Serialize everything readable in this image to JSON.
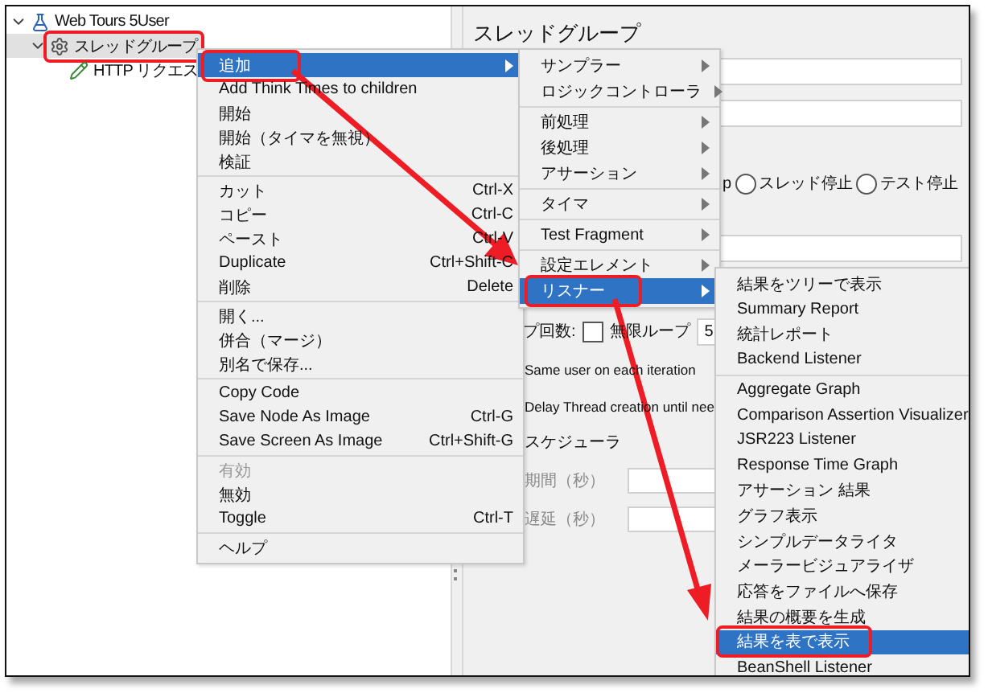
{
  "tree": [
    {
      "kind": "test_plan",
      "label": "Web Tours 5User",
      "expanded": true,
      "selected": false,
      "annotated": false,
      "children": [
        {
          "kind": "thread_group",
          "label": "スレッドグループ",
          "expanded": true,
          "selected": true,
          "annotated": true,
          "children": [
            {
              "kind": "sampler",
              "label": "HTTP リクエス",
              "selected": false,
              "annotated": false
            }
          ]
        }
      ]
    }
  ],
  "editor": {
    "title": "スレッドグループ",
    "error_action": {
      "partial_label": "p",
      "options": [
        {
          "label": "スレッド停止",
          "selected": false
        },
        {
          "label": "テスト停止",
          "selected": false
        }
      ]
    },
    "loop_count": {
      "label": "プ回数:",
      "infinite": {
        "label": "無限ループ",
        "checked": false
      },
      "value": "5"
    },
    "options": [
      {
        "label": "Same user on each iteration"
      },
      {
        "label": "Delay Thread creation until nee"
      }
    ],
    "scheduler_label": "スケジューラ",
    "timing_fields": [
      {
        "label": "期間（秒）",
        "disabled": true
      },
      {
        "label": "遅延（秒）",
        "disabled": true
      }
    ]
  },
  "context_menu": {
    "groups": [
      [
        {
          "label": "追加",
          "has_submenu": true,
          "selected": true,
          "disabled": false,
          "annotated": true
        },
        {
          "label": "Add Think Times to children",
          "has_submenu": false,
          "selected": false,
          "disabled": false,
          "annotated": false
        },
        {
          "label": "開始",
          "has_submenu": false,
          "selected": false,
          "disabled": false,
          "annotated": false
        },
        {
          "label": "開始（タイマを無視）",
          "has_submenu": false,
          "selected": false,
          "disabled": false,
          "annotated": false
        },
        {
          "label": "検証",
          "has_submenu": false,
          "selected": false,
          "disabled": false,
          "annotated": false
        }
      ],
      [
        {
          "label": "カット",
          "shortcut": "Ctrl-X",
          "has_submenu": false,
          "selected": false,
          "disabled": false,
          "annotated": false
        },
        {
          "label": "コピー",
          "shortcut": "Ctrl-C",
          "has_submenu": false,
          "selected": false,
          "disabled": false,
          "annotated": false
        },
        {
          "label": "ペースト",
          "shortcut": "Ctrl-V",
          "has_submenu": false,
          "selected": false,
          "disabled": false,
          "annotated": false
        },
        {
          "label": "Duplicate",
          "shortcut": "Ctrl+Shift-C",
          "has_submenu": false,
          "selected": false,
          "disabled": false,
          "annotated": false
        },
        {
          "label": "削除",
          "shortcut": "Delete",
          "has_submenu": false,
          "selected": false,
          "disabled": false,
          "annotated": false
        }
      ],
      [
        {
          "label": "開く...",
          "has_submenu": false,
          "selected": false,
          "disabled": false,
          "annotated": false
        },
        {
          "label": "併合（マージ）",
          "has_submenu": false,
          "selected": false,
          "disabled": false,
          "annotated": false
        },
        {
          "label": "別名で保存...",
          "has_submenu": false,
          "selected": false,
          "disabled": false,
          "annotated": false
        }
      ],
      [
        {
          "label": "Copy Code",
          "has_submenu": false,
          "selected": false,
          "disabled": false,
          "annotated": false
        },
        {
          "label": "Save Node As Image",
          "shortcut": "Ctrl-G",
          "has_submenu": false,
          "selected": false,
          "disabled": false,
          "annotated": false
        },
        {
          "label": "Save Screen As Image",
          "shortcut": "Ctrl+Shift-G",
          "has_submenu": false,
          "selected": false,
          "disabled": false,
          "annotated": false
        }
      ],
      [
        {
          "label": "有効",
          "has_submenu": false,
          "selected": false,
          "disabled": true,
          "annotated": false
        },
        {
          "label": "無効",
          "has_submenu": false,
          "selected": false,
          "disabled": false,
          "annotated": false
        },
        {
          "label": "Toggle",
          "shortcut": "Ctrl-T",
          "has_submenu": false,
          "selected": false,
          "disabled": false,
          "annotated": false
        }
      ],
      [
        {
          "label": "ヘルプ",
          "has_submenu": false,
          "selected": false,
          "disabled": false,
          "annotated": false
        }
      ]
    ]
  },
  "add_submenu": {
    "groups": [
      [
        {
          "label": "サンプラー",
          "has_submenu": true,
          "selected": false,
          "annotated": false
        },
        {
          "label": "ロジックコントローラ",
          "has_submenu": true,
          "selected": false,
          "annotated": false
        }
      ],
      [
        {
          "label": "前処理",
          "has_submenu": true,
          "selected": false,
          "annotated": false
        },
        {
          "label": "後処理",
          "has_submenu": true,
          "selected": false,
          "annotated": false
        },
        {
          "label": "アサーション",
          "has_submenu": true,
          "selected": false,
          "annotated": false
        }
      ],
      [
        {
          "label": "タイマ",
          "has_submenu": true,
          "selected": false,
          "annotated": false
        }
      ],
      [
        {
          "label": "Test Fragment",
          "has_submenu": true,
          "selected": false,
          "annotated": false
        }
      ],
      [
        {
          "label": "設定エレメント",
          "has_submenu": true,
          "selected": false,
          "annotated": false
        },
        {
          "label": "リスナー",
          "has_submenu": true,
          "selected": true,
          "annotated": true
        }
      ]
    ]
  },
  "listener_submenu": {
    "groups": [
      [
        {
          "label": "結果をツリーで表示",
          "selected": false,
          "annotated": false
        },
        {
          "label": "Summary Report",
          "selected": false,
          "annotated": false
        },
        {
          "label": "統計レポート",
          "selected": false,
          "annotated": false
        },
        {
          "label": "Backend Listener",
          "selected": false,
          "annotated": false
        }
      ],
      [
        {
          "label": "Aggregate Graph",
          "selected": false,
          "annotated": false
        },
        {
          "label": "Comparison Assertion Visualizer",
          "selected": false,
          "annotated": false
        },
        {
          "label": "JSR223 Listener",
          "selected": false,
          "annotated": false
        },
        {
          "label": "Response Time Graph",
          "selected": false,
          "annotated": false
        },
        {
          "label": "アサーション 結果",
          "selected": false,
          "annotated": false
        },
        {
          "label": "グラフ表示",
          "selected": false,
          "annotated": false
        },
        {
          "label": "シンプルデータライタ",
          "selected": false,
          "annotated": false
        },
        {
          "label": "メーラービジュアライザ",
          "selected": false,
          "annotated": false
        },
        {
          "label": "応答をファイルへ保存",
          "selected": false,
          "annotated": false
        },
        {
          "label": "結果の概要を生成",
          "selected": false,
          "annotated": false
        },
        {
          "label": "結果を表で表示",
          "selected": true,
          "annotated": true
        },
        {
          "label": "BeanShell Listener",
          "selected": false,
          "annotated": false
        }
      ]
    ]
  }
}
